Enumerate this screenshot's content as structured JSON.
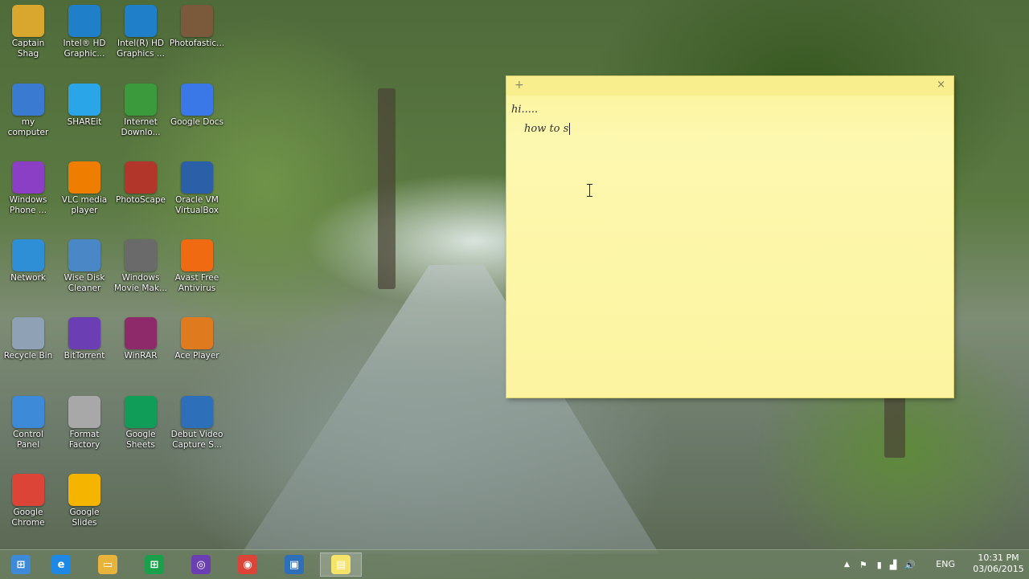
{
  "desktop_icons": [
    {
      "label": "Captain Shag",
      "icon": "folder-user-icon",
      "color": "#d9a62e"
    },
    {
      "label": "Intel® HD\nGraphic...",
      "icon": "intel-graphics-icon",
      "color": "#1f7fc8"
    },
    {
      "label": "Intel(R) HD\nGraphics ...",
      "icon": "intel-graphics-icon",
      "color": "#1f7fc8"
    },
    {
      "label": "Photofastic...",
      "icon": "photo-collage-icon",
      "color": "#7a5a3a"
    },
    {
      "label": "my\ncomputer",
      "icon": "computer-icon",
      "color": "#3a7ad1"
    },
    {
      "label": "SHAREit",
      "icon": "shareit-icon",
      "color": "#2aa6e8"
    },
    {
      "label": "Internet\nDownlo...",
      "icon": "idm-globe-icon",
      "color": "#3b9a3b"
    },
    {
      "label": "Google Docs",
      "icon": "google-docs-icon",
      "color": "#3b78e7"
    },
    {
      "label": "Windows\nPhone ...",
      "icon": "windows-phone-icon",
      "color": "#8b3fc4"
    },
    {
      "label": "VLC media\nplayer",
      "icon": "vlc-cone-icon",
      "color": "#ef7d00"
    },
    {
      "label": "PhotoScape",
      "icon": "photoscape-icon",
      "color": "#b3362b"
    },
    {
      "label": "Oracle VM\nVirtualBox",
      "icon": "virtualbox-icon",
      "color": "#2b5fa8"
    },
    {
      "label": "Network",
      "icon": "network-globe-icon",
      "color": "#2f8fd6"
    },
    {
      "label": "Wise Disk\nCleaner",
      "icon": "disk-cleaner-icon",
      "color": "#4a87c6"
    },
    {
      "label": "Windows\nMovie Mak...",
      "icon": "movie-maker-icon",
      "color": "#6a6a6a"
    },
    {
      "label": "Avast Free\nAntivirus",
      "icon": "avast-icon",
      "color": "#f06a12"
    },
    {
      "label": "Recycle Bin",
      "icon": "recycle-bin-icon",
      "color": "#8fa2b5"
    },
    {
      "label": "BitTorrent",
      "icon": "bittorrent-icon",
      "color": "#6b3fb3"
    },
    {
      "label": "WinRAR",
      "icon": "winrar-icon",
      "color": "#8e2a6a"
    },
    {
      "label": "Ace Player",
      "icon": "ace-player-icon",
      "color": "#e07a1f"
    },
    {
      "label": "Control\nPanel",
      "icon": "control-panel-icon",
      "color": "#3c8ad8"
    },
    {
      "label": "Format\nFactory",
      "icon": "format-factory-icon",
      "color": "#a8a8a8"
    },
    {
      "label": "Google\nSheets",
      "icon": "google-sheets-icon",
      "color": "#0f9d58"
    },
    {
      "label": "Debut Video\nCapture S...",
      "icon": "debut-capture-icon",
      "color": "#2d6fb8"
    },
    {
      "label": "Google\nChrome",
      "icon": "chrome-icon",
      "color": "#db4437"
    },
    {
      "label": "Google Slides",
      "icon": "google-slides-icon",
      "color": "#f4b400"
    }
  ],
  "sticky_note": {
    "add_glyph": "+",
    "close_glyph": "×",
    "line1": "hi.....",
    "line2": "how to s"
  },
  "taskbar": {
    "apps": [
      {
        "name": "start-button",
        "icon": "windows-logo-icon",
        "color": "#3c8ad8",
        "glyph": "⊞"
      },
      {
        "name": "taskbar-internet-explorer",
        "icon": "internet-explorer-icon",
        "color": "#1e88e5",
        "glyph": "e"
      },
      {
        "name": "taskbar-file-explorer",
        "icon": "folder-icon",
        "color": "#e8b33a",
        "glyph": "▭"
      },
      {
        "name": "taskbar-store",
        "icon": "store-bag-icon",
        "color": "#1aa04a",
        "glyph": "⊞"
      },
      {
        "name": "taskbar-bittorrent",
        "icon": "bittorrent-icon",
        "color": "#6b3fb3",
        "glyph": "◎"
      },
      {
        "name": "taskbar-chrome",
        "icon": "chrome-icon",
        "color": "#db4437",
        "glyph": "◉"
      },
      {
        "name": "taskbar-debut-capture",
        "icon": "debut-capture-icon",
        "color": "#2d6fb8",
        "glyph": "▣"
      },
      {
        "name": "taskbar-sticky-notes",
        "icon": "sticky-notes-icon",
        "color": "#f5e36a",
        "glyph": "▤"
      }
    ],
    "language": "ENG",
    "time": "10:31 PM",
    "date": "03/06/2015"
  }
}
